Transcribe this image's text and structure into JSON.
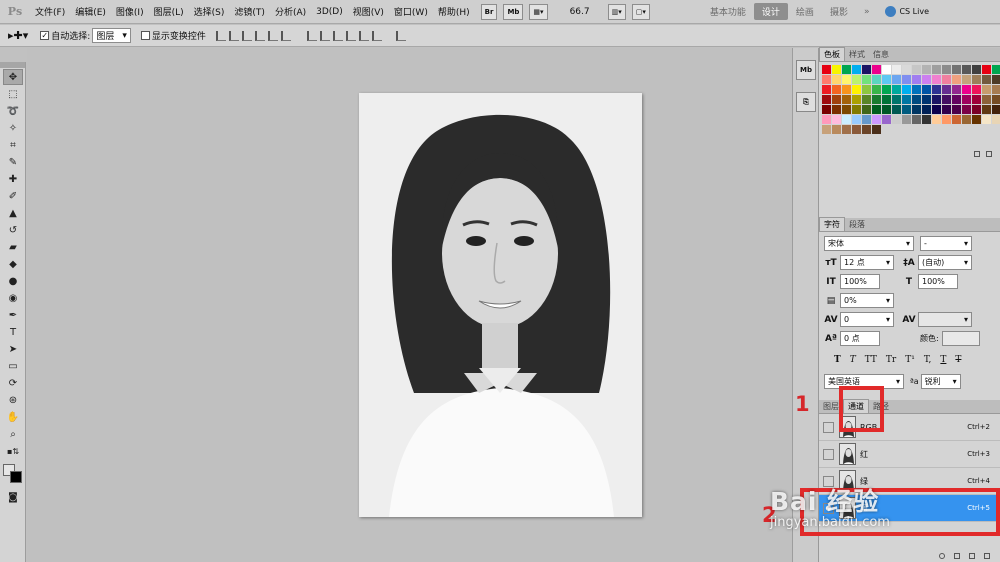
{
  "app": {
    "logo": "Ps"
  },
  "menu": [
    "文件(F)",
    "编辑(E)",
    "图像(I)",
    "图层(L)",
    "选择(S)",
    "滤镜(T)",
    "分析(A)",
    "3D(D)",
    "视图(V)",
    "窗口(W)",
    "帮助(H)"
  ],
  "menubar_controls": {
    "br": "Br",
    "mb": "Mb",
    "zoom": "66.7"
  },
  "workspaces": [
    "基本功能",
    "设计",
    "绘画",
    "摄影"
  ],
  "workspace_active": "设计",
  "more": "»",
  "cs_live": "CS Live",
  "options": {
    "auto_select_label": "自动选择:",
    "auto_select_value": "图层",
    "show_transform": "显示变换控件"
  },
  "swatches_tabs": [
    "色板",
    "样式",
    "信息"
  ],
  "swatch_colors": [
    "#e60012",
    "#f8f400",
    "#00a650",
    "#00aeef",
    "#1b1464",
    "#ec008c",
    "#ffffff",
    "#ececec",
    "#d9d9d9",
    "#c6c6c6",
    "#b3b3b3",
    "#9f9f9f",
    "#8c8c8c",
    "#737373",
    "#595959",
    "#404040",
    "#e60012",
    "#00a650",
    "#ff7b6e",
    "#ffd66e",
    "#fff56e",
    "#bdf26e",
    "#72e27c",
    "#5bd6bf",
    "#5cc8f2",
    "#6ca6f0",
    "#7f8ef0",
    "#a07df0",
    "#cc7ff0",
    "#f07fcf",
    "#f07f9f",
    "#f0a07f",
    "#c4a37c",
    "#9c7e5a",
    "#735a3e",
    "#4d3b27",
    "#ed1c24",
    "#f26522",
    "#f7941d",
    "#fff200",
    "#8dc63f",
    "#39b54a",
    "#00a651",
    "#00a99d",
    "#00aeef",
    "#0072bc",
    "#0054a6",
    "#2e3192",
    "#662d91",
    "#92278f",
    "#ec008c",
    "#ed145b",
    "#c69c6d",
    "#a67c52",
    "#9e0b0f",
    "#a0410d",
    "#a36209",
    "#aba000",
    "#598527",
    "#1a7b30",
    "#007236",
    "#00746b",
    "#0076a3",
    "#004a80",
    "#003471",
    "#1b1464",
    "#440e62",
    "#630460",
    "#9e005d",
    "#9e0039",
    "#8c6239",
    "#754c24",
    "#790000",
    "#7b2e00",
    "#7d4900",
    "#827b00",
    "#406618",
    "#005e20",
    "#005826",
    "#005952",
    "#005b7f",
    "#003663",
    "#002157",
    "#0d004c",
    "#32004b",
    "#4b0049",
    "#7b0046",
    "#7a0026",
    "#603913",
    "#42210b",
    "#f9b",
    "#fbd",
    "#cef",
    "#9cf",
    "#69c",
    "#c9f",
    "#96c",
    "#ccc",
    "#999",
    "#666",
    "#333",
    "#fc9",
    "#f96",
    "#c63",
    "#963",
    "#630",
    "#f5e6c8",
    "#e8d5b5",
    "#c7a17a",
    "#b98a5d",
    "#a0704a",
    "#8a5a3a",
    "#6b4428",
    "#4a2e1a"
  ],
  "character": {
    "tabs": [
      "字符",
      "段落"
    ],
    "font_family": "宋体",
    "font_style": "-",
    "size": "12 点",
    "leading": "(自动)",
    "vscale": "100%",
    "hscale": "100%",
    "baseline_pct": "0%",
    "kerning": "0",
    "baseline_shift": "0 点",
    "color_label": "颜色:",
    "style_buttons": [
      "T",
      "T",
      "TT",
      "Tr",
      "T¹",
      "T,",
      "T",
      "T"
    ],
    "language": "美国英语",
    "aa_prefix": "ªa",
    "antialias": "锐利"
  },
  "channels": {
    "tabs": [
      "图层",
      "通道",
      "路径"
    ],
    "rows": [
      {
        "name": "RGB",
        "shortcut": "Ctrl+2",
        "visible": false
      },
      {
        "name": "红",
        "shortcut": "Ctrl+3",
        "visible": false
      },
      {
        "name": "绿",
        "shortcut": "Ctrl+4",
        "visible": false
      },
      {
        "name": "蓝",
        "shortcut": "Ctrl+5",
        "visible": true,
        "selected": true
      }
    ]
  },
  "annotations": {
    "one": "1",
    "two": "2",
    "color": "#e12a2a"
  },
  "watermark": {
    "brand": "Bai 经验",
    "url": "jingyan.baidu.com"
  }
}
